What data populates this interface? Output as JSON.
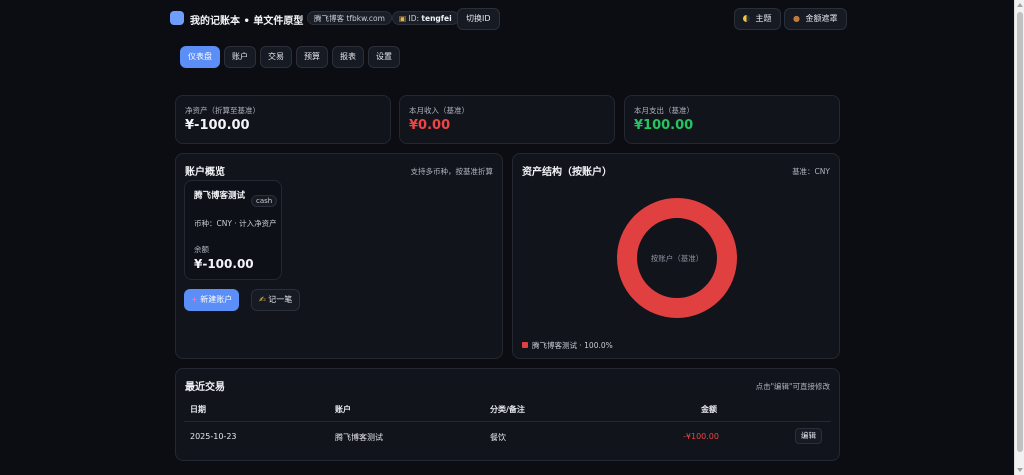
{
  "header": {
    "title": "我的记账本 • 单文件原型",
    "site": "腾飞博客 tfbkw.com",
    "id_prefix": "ID:",
    "id_value": "tengfei",
    "switch_id": "切换ID",
    "theme_label": "主题",
    "mask_label": "金额遮罩",
    "colors": {
      "accent": "#5b8ef7",
      "logo": "#6f9dfb"
    }
  },
  "nav": {
    "tabs": [
      {
        "label": "仪表盘",
        "active": true
      },
      {
        "label": "账户"
      },
      {
        "label": "交易"
      },
      {
        "label": "预算"
      },
      {
        "label": "报表"
      },
      {
        "label": "设置"
      }
    ]
  },
  "stats": {
    "net_assets": {
      "label": "净资产（折算至基准）",
      "value": "¥-100.00"
    },
    "month_income": {
      "label": "本月收入（基准）",
      "value": "¥0.00",
      "color": "#ef4444"
    },
    "month_expense": {
      "label": "本月支出（基准）",
      "value": "¥100.00",
      "color": "#22c55e"
    }
  },
  "accounts": {
    "title": "账户概览",
    "hint": "支持多币种，按基准折算",
    "items": [
      {
        "name": "腾飞博客测试",
        "type": "cash",
        "meta": "币种：CNY · 计入净资产",
        "balance_label": "余额",
        "balance": "¥-100.00"
      }
    ],
    "new_account": "新建账户",
    "record": "记一笔"
  },
  "asset_structure": {
    "title": "资产结构（按账户）",
    "base": "基准：CNY",
    "donut_center": "按账户（基准）",
    "legend": [
      {
        "label": "腾飞博客测试 · 100.0%",
        "color": "#e04040"
      }
    ]
  },
  "chart_data": {
    "type": "pie",
    "categories": [
      "腾飞博客测试"
    ],
    "values": [
      100.0
    ],
    "title": "资产结构（按账户）"
  },
  "recent": {
    "title": "最近交易",
    "hint": "点击\"编辑\"可直接修改",
    "columns": [
      "日期",
      "账户",
      "分类/备注",
      "金额"
    ],
    "rows": [
      {
        "date": "2025-10-23",
        "account": "腾飞博客测试",
        "category": "餐饮",
        "amount": "-¥100.00",
        "action": "编辑"
      }
    ]
  }
}
